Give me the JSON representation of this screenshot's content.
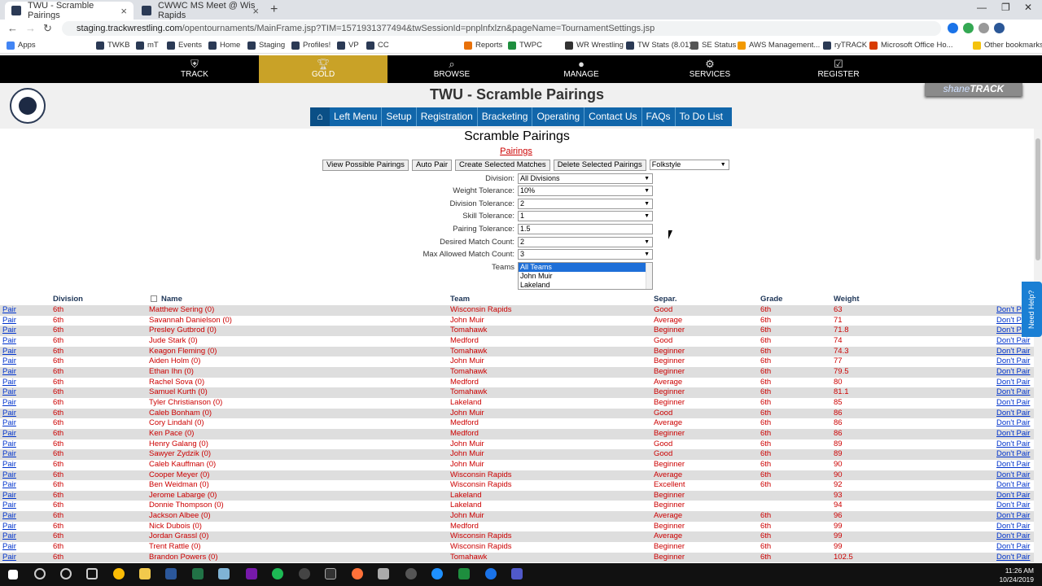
{
  "browser": {
    "tabs": [
      {
        "title": "TWU - Scramble Pairings",
        "active": true
      },
      {
        "title": "CWWC MS Meet @ Wis Rapids",
        "active": false
      }
    ],
    "url_host": "staging.trackwrestling.com",
    "url_path": "/opentournaments/MainFrame.jsp?TIM=1571931377494&twSessionId=pnplnfxlzn&pageName=TournamentSettings.jsp",
    "bookmarks": [
      "Apps",
      "TWKB",
      "mT",
      "Events",
      "Home",
      "Staging",
      "Profiles!",
      "VP",
      "CC",
      "Reports",
      "TWPC",
      "WR Wrestling",
      "TW Stats (8.01)",
      "SE Status",
      "AWS Management...",
      "ryTRACK",
      "Microsoft Office Ho...",
      "Other bookmarks"
    ]
  },
  "topnav": {
    "items": [
      {
        "label": "TRACK",
        "icon": "shield-icon"
      },
      {
        "label": "GOLD",
        "icon": "trophy-icon"
      },
      {
        "label": "BROWSE",
        "icon": "search-icon"
      },
      {
        "label": "MANAGE",
        "icon": "user-icon"
      },
      {
        "label": "SERVICES",
        "icon": "gear-icon"
      },
      {
        "label": "REGISTER",
        "icon": "clipboard-check-icon"
      }
    ]
  },
  "banner": {
    "title": "TWU - Scramble Pairings",
    "badge_prefix": "shane",
    "badge_suffix": "TRACK"
  },
  "menu": {
    "items": [
      "Left Menu",
      "Setup",
      "Registration",
      "Bracketing",
      "Operating",
      "Contact Us",
      "FAQs",
      "To Do List"
    ]
  },
  "page": {
    "title": "Scramble Pairings",
    "link": "Pairings",
    "buttons": [
      "View Possible Pairings",
      "Auto Pair",
      "Create Selected Matches",
      "Delete Selected Pairings"
    ],
    "style_select": "Folkstyle",
    "fields": [
      {
        "label": "Division:",
        "value": "All Divisions",
        "type": "select"
      },
      {
        "label": "Weight Tolerance:",
        "value": "10%",
        "type": "select"
      },
      {
        "label": "Division Tolerance:",
        "value": "2",
        "type": "select"
      },
      {
        "label": "Skill Tolerance:",
        "value": "1",
        "type": "select"
      },
      {
        "label": "Pairing Tolerance:",
        "value": "1.5",
        "type": "input"
      },
      {
        "label": "Desired Match Count:",
        "value": "2",
        "type": "select"
      },
      {
        "label": "Max Allowed Match Count:",
        "value": "3",
        "type": "select"
      }
    ],
    "teams_label": "Teams",
    "teams_options": [
      "All Teams",
      "John Muir",
      "Lakeland"
    ]
  },
  "table": {
    "headers": {
      "division": "Division",
      "name": "Name",
      "team": "Team",
      "separ": "Separ.",
      "grade": "Grade",
      "weight": "Weight"
    },
    "pair_label": "Pair",
    "dontpair_label": "Don't Pair",
    "rows": [
      {
        "division": "6th",
        "name": "Matthew Sering (0)",
        "team": "Wisconsin Rapids",
        "separ": "Good",
        "grade": "6th",
        "weight": "63"
      },
      {
        "division": "6th",
        "name": "Savannah Danielson (0)",
        "team": "John Muir",
        "separ": "Average",
        "grade": "6th",
        "weight": "71"
      },
      {
        "division": "6th",
        "name": "Presley Gutbrod (0)",
        "team": "Tomahawk",
        "separ": "Beginner",
        "grade": "6th",
        "weight": "71.8"
      },
      {
        "division": "6th",
        "name": "Jude Stark (0)",
        "team": "Medford",
        "separ": "Good",
        "grade": "6th",
        "weight": "74"
      },
      {
        "division": "6th",
        "name": "Keagon Fleming (0)",
        "team": "Tomahawk",
        "separ": "Beginner",
        "grade": "6th",
        "weight": "74.3"
      },
      {
        "division": "6th",
        "name": "Aiden Holm (0)",
        "team": "John Muir",
        "separ": "Beginner",
        "grade": "6th",
        "weight": "77"
      },
      {
        "division": "6th",
        "name": "Ethan Ihn (0)",
        "team": "Tomahawk",
        "separ": "Beginner",
        "grade": "6th",
        "weight": "79.5"
      },
      {
        "division": "6th",
        "name": "Rachel Sova (0)",
        "team": "Medford",
        "separ": "Average",
        "grade": "6th",
        "weight": "80"
      },
      {
        "division": "6th",
        "name": "Samuel Kurth (0)",
        "team": "Tomahawk",
        "separ": "Beginner",
        "grade": "6th",
        "weight": "81.1"
      },
      {
        "division": "6th",
        "name": "Tyler Christianson (0)",
        "team": "Lakeland",
        "separ": "Beginner",
        "grade": "6th",
        "weight": "85"
      },
      {
        "division": "6th",
        "name": "Caleb Bonham (0)",
        "team": "John Muir",
        "separ": "Good",
        "grade": "6th",
        "weight": "86"
      },
      {
        "division": "6th",
        "name": "Cory Lindahl (0)",
        "team": "Medford",
        "separ": "Average",
        "grade": "6th",
        "weight": "86"
      },
      {
        "division": "6th",
        "name": "Ken Pace (0)",
        "team": "Medford",
        "separ": "Beginner",
        "grade": "6th",
        "weight": "86"
      },
      {
        "division": "6th",
        "name": "Henry Galang (0)",
        "team": "John Muir",
        "separ": "Good",
        "grade": "6th",
        "weight": "89"
      },
      {
        "division": "6th",
        "name": "Sawyer Zydzik (0)",
        "team": "John Muir",
        "separ": "Good",
        "grade": "6th",
        "weight": "89"
      },
      {
        "division": "6th",
        "name": "Caleb Kauffman (0)",
        "team": "John Muir",
        "separ": "Beginner",
        "grade": "6th",
        "weight": "90"
      },
      {
        "division": "6th",
        "name": "Cooper Meyer (0)",
        "team": "Wisconsin Rapids",
        "separ": "Average",
        "grade": "6th",
        "weight": "90"
      },
      {
        "division": "6th",
        "name": "Ben Weidman (0)",
        "team": "Wisconsin Rapids",
        "separ": "Excellent",
        "grade": "6th",
        "weight": "92"
      },
      {
        "division": "6th",
        "name": "Jerome Labarge (0)",
        "team": "Lakeland",
        "separ": "Beginner",
        "grade": "",
        "weight": "93"
      },
      {
        "division": "6th",
        "name": "Donnie Thompson (0)",
        "team": "Lakeland",
        "separ": "Beginner",
        "grade": "",
        "weight": "94"
      },
      {
        "division": "6th",
        "name": "Jackson Albee (0)",
        "team": "John Muir",
        "separ": "Average",
        "grade": "6th",
        "weight": "96"
      },
      {
        "division": "6th",
        "name": "Nick Dubois (0)",
        "team": "Medford",
        "separ": "Beginner",
        "grade": "6th",
        "weight": "99"
      },
      {
        "division": "6th",
        "name": "Jordan Grassl (0)",
        "team": "Wisconsin Rapids",
        "separ": "Average",
        "grade": "6th",
        "weight": "99"
      },
      {
        "division": "6th",
        "name": "Trent Rattle (0)",
        "team": "Wisconsin Rapids",
        "separ": "Beginner",
        "grade": "6th",
        "weight": "99"
      },
      {
        "division": "6th",
        "name": "Brandon Powers (0)",
        "team": "Tomahawk",
        "separ": "Beginner",
        "grade": "6th",
        "weight": "102.5"
      }
    ]
  },
  "help": {
    "label": "Need Help?"
  },
  "taskbar": {
    "time": "11:26 AM",
    "date": "10/24/2019"
  },
  "colors": {
    "gold": "#c9a227",
    "menu_blue": "#1166aa",
    "row_text": "#cc0000",
    "link_blue": "#0033cc"
  }
}
